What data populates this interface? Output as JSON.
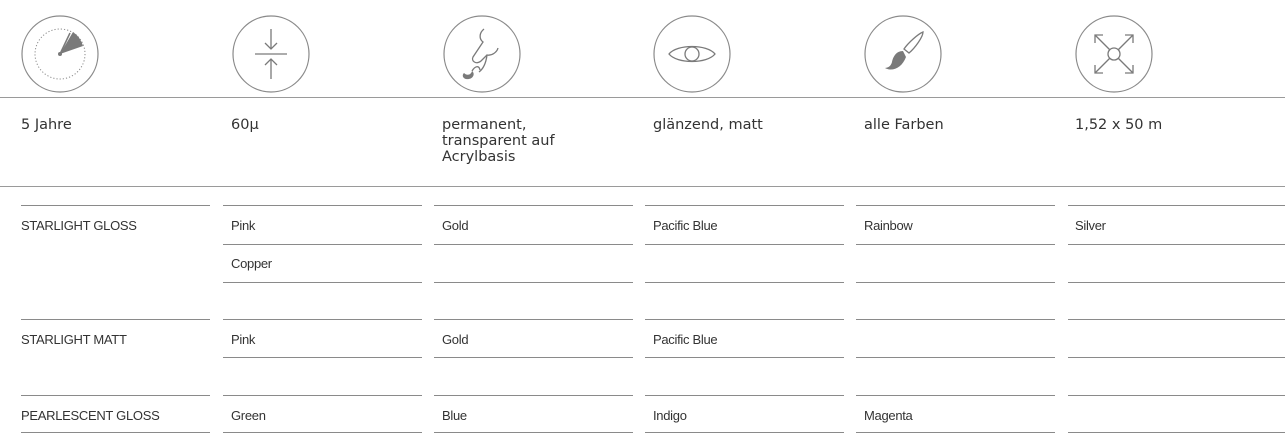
{
  "specs": {
    "durability": "5 Jahre",
    "thickness": "60µ",
    "adhesive": "permanent, transparent auf Acrylbasis",
    "finish": "glänzend, matt",
    "colors": "alle Farben",
    "size": "1,52 x 50 m"
  },
  "icons": [
    "clock-icon",
    "thickness-arrows-icon",
    "adhesive-drop-icon",
    "eye-icon",
    "paintbrush-icon",
    "expand-arrows-icon"
  ],
  "products": [
    {
      "name": "STARLIGHT GLOSS",
      "rows": [
        [
          "Pink",
          "Gold",
          "Pacific Blue",
          "Rainbow",
          "Silver"
        ],
        [
          "Copper",
          "",
          "",
          "",
          ""
        ]
      ]
    },
    {
      "name": "STARLIGHT MATT",
      "rows": [
        [
          "Pink",
          "Gold",
          "Pacific Blue",
          "",
          ""
        ]
      ]
    },
    {
      "name": "PEARLESCENT GLOSS",
      "rows": [
        [
          "Green",
          "Blue",
          "Indigo",
          "Magenta",
          ""
        ]
      ]
    }
  ]
}
